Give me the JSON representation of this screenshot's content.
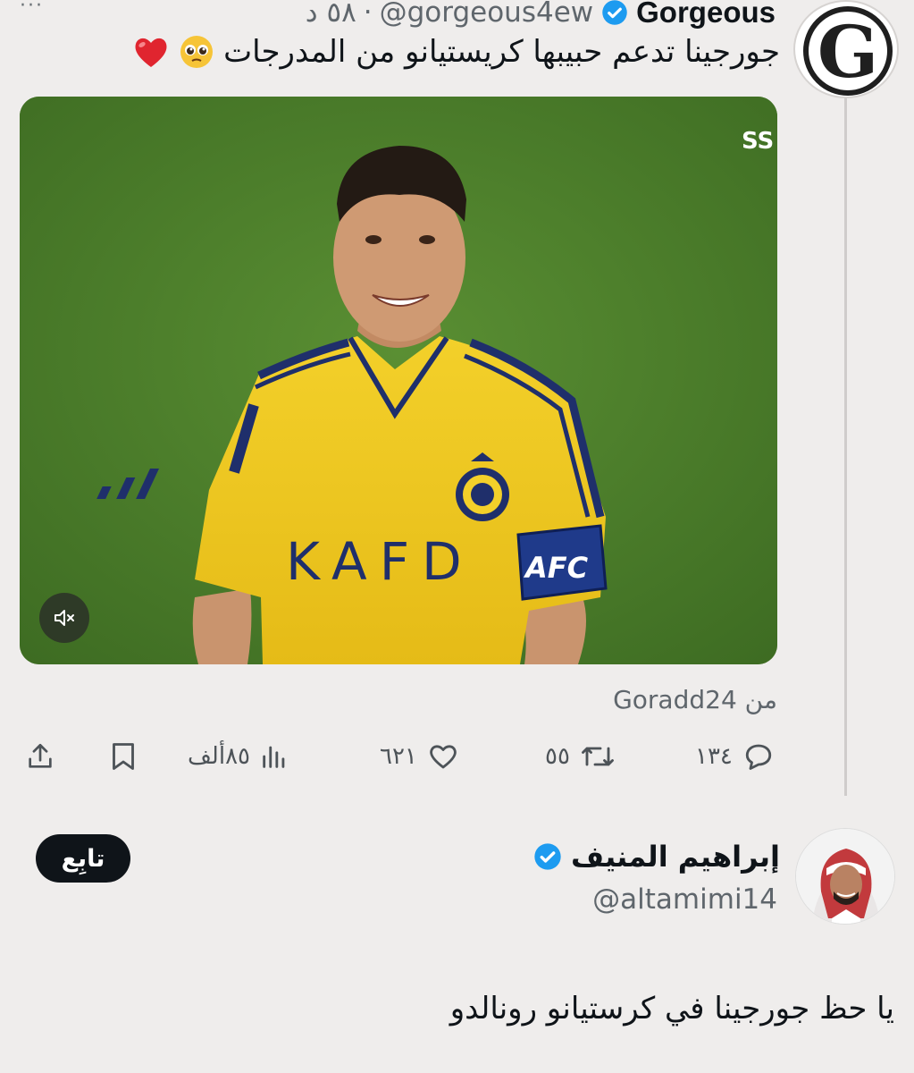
{
  "tweet": {
    "more_label": "···",
    "author_name": "Gorgeous",
    "handle": "@gorgeous4ew",
    "separator": "·",
    "time": "٥٨ د",
    "text": "جورجينا تدعم حبيبها كريستيانو من المدرجات",
    "emojis": [
      "pleading-face",
      "red-heart"
    ],
    "avatar_letter": "G",
    "media": {
      "jersey_sponsor": "KAFD",
      "armband": "AFC",
      "channel_logo": "SS",
      "mute_icon": "speaker-muted-icon"
    },
    "source_label": "من Goradd24"
  },
  "actions": {
    "replies": "١٣٤",
    "retweets": "٥٥",
    "likes": "٦٢١",
    "views": "٨٥ألف"
  },
  "reply_user": {
    "name": "إبراهيم المنيف",
    "handle": "@altamimi14",
    "follow_label": "تابِع",
    "text": "يا حظ جورجينا في كرستيانو رونالدو"
  },
  "colors": {
    "background": "#efedec",
    "verified_blue": "#1d9bf0",
    "verified_gold": "#e2b719",
    "text": "#0f1419",
    "muted": "#5f666c"
  }
}
